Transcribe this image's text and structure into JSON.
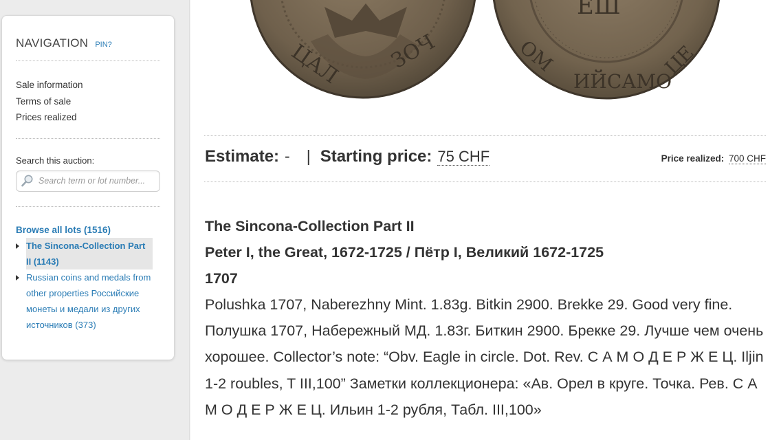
{
  "nav": {
    "title": "NAVIGATION",
    "pin": "PIN?",
    "links": [
      "Sale information",
      "Terms of sale",
      "Prices realized"
    ],
    "search_label": "Search this auction:",
    "search_placeholder": "Search term or lot number...",
    "browse_all": "Browse all lots (1516)",
    "categories": [
      {
        "label": "The Sincona-Collection Part II (1143)",
        "active": true
      },
      {
        "label": "Russian coins and medals from other properties Российские монеты и медали из других источников (373)",
        "active": false
      }
    ]
  },
  "lot": {
    "estimate_label": "Estimate:",
    "estimate_value": "-",
    "separator": "|",
    "starting_label": "Starting price:",
    "starting_value": "75 CHF",
    "realized_label": "Price realized:",
    "realized_value": "700 CHF",
    "heading1": "The Sincona-Collection Part II",
    "heading2": "Peter I, the Great, 1672-1725 / Пётр I, Великий 1672-1725",
    "heading3": "1707",
    "description": "Polushka 1707, Naberezhny Mint. 1.83g. Bitkin 2900. Brekke 29. Good very fine. Полушка 1707, Набережный МД. 1.83г. Биткин 2900. Брекке 29. Лучше чем очень хорошее. Collector’s note: “Obv. Eagle in circle. Dot. Rev. С А М О Д Е Р Ж Е Ц. Iljin 1-2 roubles, T III,100” Заметки коллекционера: «Ав. Орел в круге. Точка. Рев. С А М О Д Е Р Ж Е Ц. Ильин 1-2 рубля, Табл. III,100»"
  },
  "colors": {
    "link": "#2a7cb5",
    "coin": "#7a6a55"
  }
}
